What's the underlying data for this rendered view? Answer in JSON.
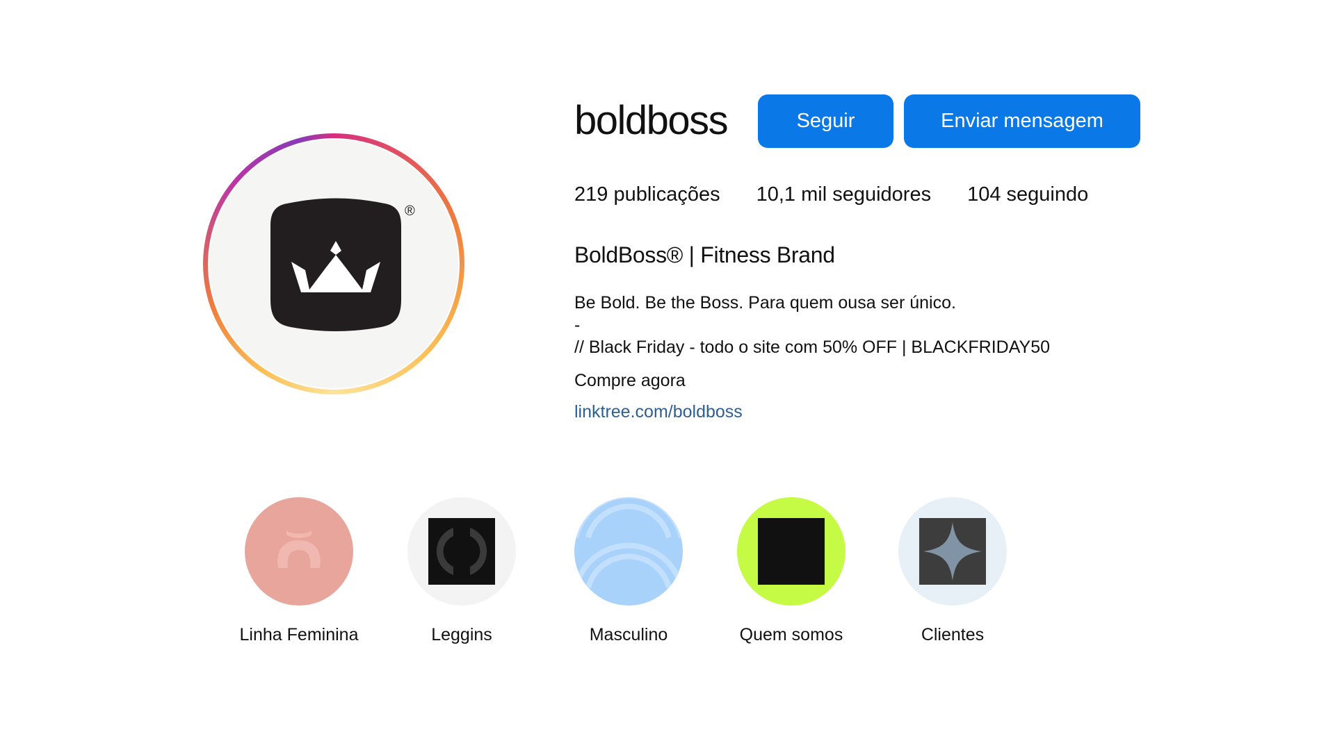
{
  "profile": {
    "username": "boldboss",
    "follow_label": "Seguir",
    "message_label": "Enviar mensagem",
    "avatar_registered_mark": "®",
    "stats": {
      "posts_count": "219",
      "posts_label": "publicações",
      "followers_count": "10,1 mil",
      "followers_label": "seguidores",
      "following_count": "104",
      "following_label": "seguindo"
    },
    "bio": {
      "name": "BoldBoss® | Fitness Brand",
      "line1": "Be Bold. Be the Boss. Para quem ousa ser único.",
      "line2": "-",
      "line3": "// Black Friday - todo o site com 50% OFF | BLACKFRIDAY50",
      "line4": "Compre agora",
      "link": "linktree.com/boldboss"
    }
  },
  "highlights": [
    {
      "label": "Linha Feminina",
      "bg": "#e8a59c"
    },
    {
      "label": "Leggins",
      "bg": "#f3f3f3"
    },
    {
      "label": "Masculino",
      "bg": "#a9d2fb"
    },
    {
      "label": "Quem somos",
      "bg": "#c6fb45"
    },
    {
      "label": "Clientes",
      "bg": "#e7f0f7"
    }
  ],
  "colors": {
    "button_bg": "#0b78e8",
    "link": "#2d5f91",
    "logo_dark": "#221e1f"
  },
  "icons": {
    "avatar": "crown-icon",
    "highlight_0": "ring-icon",
    "highlight_1": "circle-outline-icon",
    "highlight_2": "wave-arcs-icon",
    "highlight_3": "black-square-icon",
    "highlight_4": "sparkle-star-icon"
  }
}
